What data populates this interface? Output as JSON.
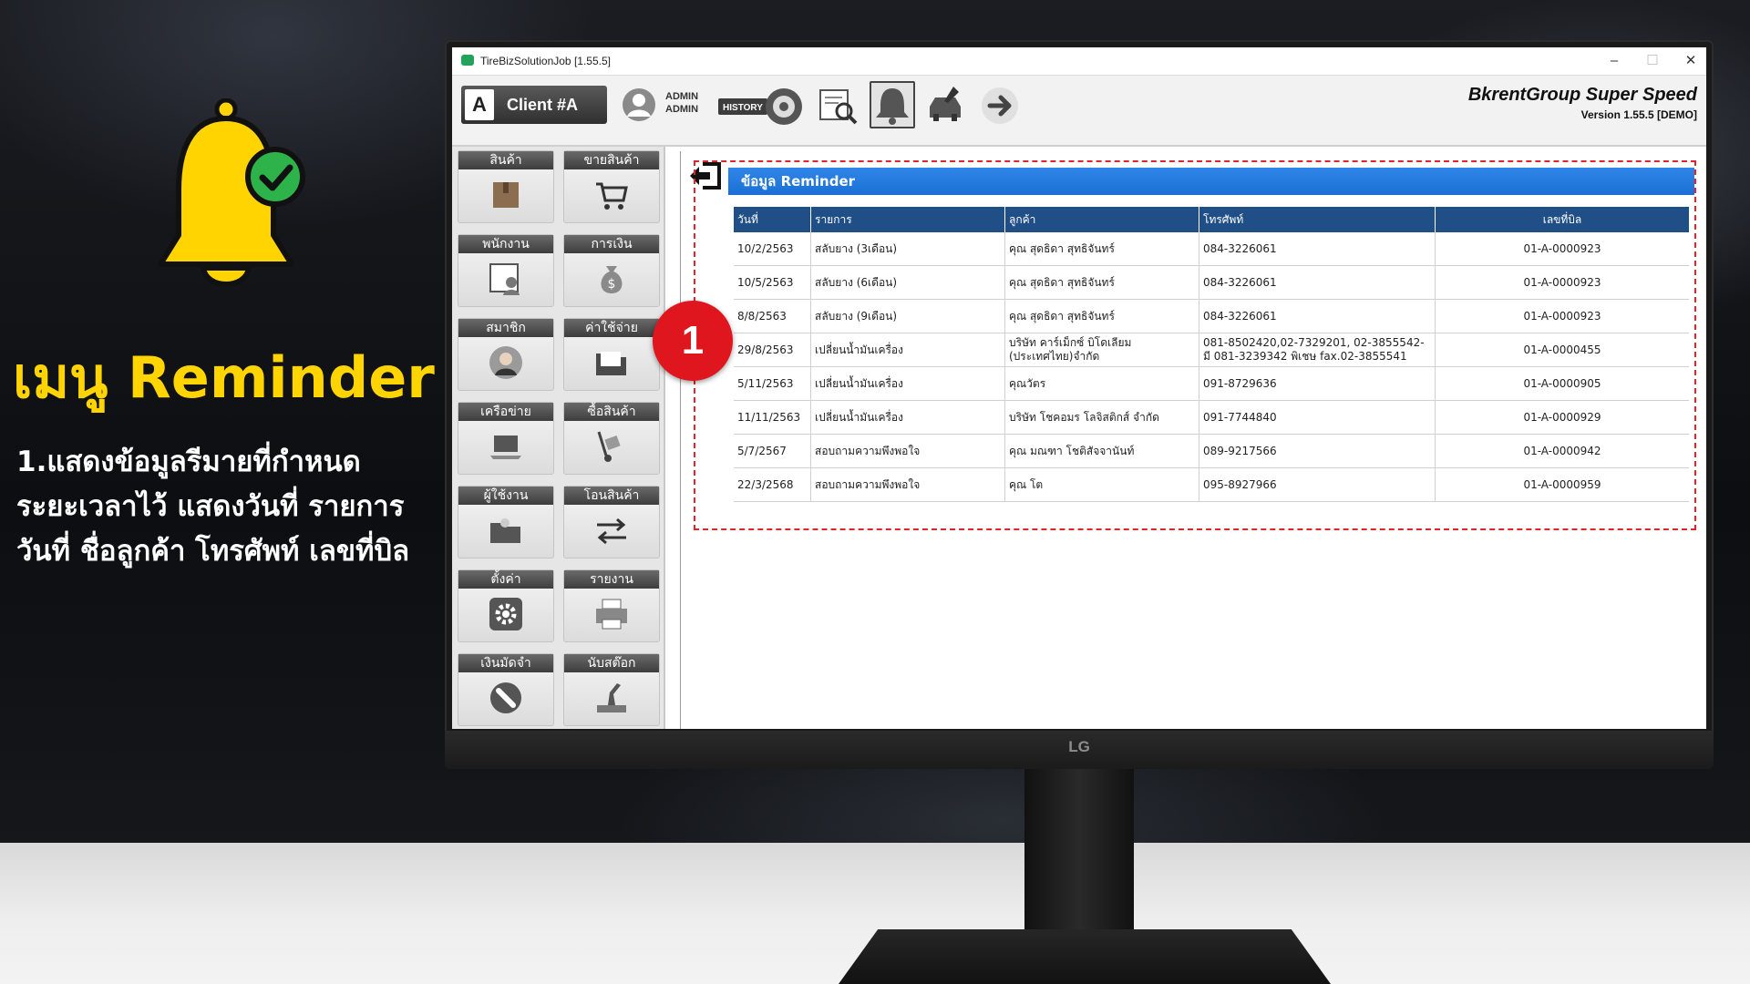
{
  "promo": {
    "title": "เมนู Reminder",
    "lines": [
      "1.แสดงข้อมูลรีมายที่กำหนด",
      "ระยะเวลาไว้ แสดงวันที่ รายการ",
      "วันที่ ชื่อลูกค้า โทรศัพท์ เลขที่บิล"
    ]
  },
  "window": {
    "title": "TireBizSolutionJob [1.55.5]",
    "minimize": "–",
    "maximize": "☐",
    "close": "✕"
  },
  "toolbar": {
    "client_letter": "A",
    "client_label": "Client #A",
    "admin_line1": "ADMIN",
    "admin_line2": "ADMIN",
    "history_label": "HISTORY",
    "brand_name": "BkrentGroup Super Speed",
    "brand_version": "Version 1.55.5 [DEMO]"
  },
  "sidebar": {
    "items": [
      {
        "label": "สินค้า",
        "icon": "box-icon"
      },
      {
        "label": "ขายสินค้า",
        "icon": "cart-icon"
      },
      {
        "label": "พนักงาน",
        "icon": "employee-icon"
      },
      {
        "label": "การเงิน",
        "icon": "money-bag-icon"
      },
      {
        "label": "สมาชิก",
        "icon": "member-icon"
      },
      {
        "label": "ค่าใช้จ่าย",
        "icon": "folder-icon"
      },
      {
        "label": "เครือข่าย",
        "icon": "laptop-icon"
      },
      {
        "label": "ซื้อสินค้า",
        "icon": "hand-truck-icon"
      },
      {
        "label": "ผู้ใช้งาน",
        "icon": "user-folder-icon"
      },
      {
        "label": "โอนสินค้า",
        "icon": "transfer-icon"
      },
      {
        "label": "ตั้งค่า",
        "icon": "gear-icon"
      },
      {
        "label": "รายงาน",
        "icon": "printer-icon"
      },
      {
        "label": "เงินมัดจำ",
        "icon": "deposit-icon"
      },
      {
        "label": "นับสต๊อก",
        "icon": "stamp-icon"
      }
    ]
  },
  "reminder": {
    "title": "ข้อมูล Reminder",
    "badge": "1",
    "columns": [
      "วันที่",
      "รายการ",
      "ลูกค้า",
      "โทรศัพท์",
      "เลขที่บิล"
    ],
    "rows": [
      {
        "date": "10/2/2563",
        "item": "สลับยาง (3เดือน)",
        "customer": "คุณ สุดธิดา สุทธิจันทร์",
        "phone": "084-3226061",
        "bill": "01-A-0000923"
      },
      {
        "date": "10/5/2563",
        "item": "สลับยาง (6เดือน)",
        "customer": "คุณ สุดธิดา สุทธิจันทร์",
        "phone": "084-3226061",
        "bill": "01-A-0000923"
      },
      {
        "date": "8/8/2563",
        "item": "สลับยาง (9เดือน)",
        "customer": "คุณ สุดธิดา สุทธิจันทร์",
        "phone": "084-3226061",
        "bill": "01-A-0000923"
      },
      {
        "date": "29/8/2563",
        "item": "เปลี่ยนน้ำมันเครื่อง",
        "customer": "บริษัท คาร์เม็กซ์ บิโดเลียม (ประเทศไทย)จำกัด",
        "phone": "081-8502420,02-7329201, 02-3855542-มี 081-3239342 พิเชษ fax.02-3855541",
        "bill": "01-A-0000455"
      },
      {
        "date": "5/11/2563",
        "item": "เปลี่ยนน้ำมันเครื่อง",
        "customer": "คุณวัตร",
        "phone": "091-8729636",
        "bill": "01-A-0000905"
      },
      {
        "date": "11/11/2563",
        "item": "เปลี่ยนน้ำมันเครื่อง",
        "customer": "บริษัท โชคอมร โลจิสติกส์ จำกัด",
        "phone": "091-7744840",
        "bill": "01-A-0000929"
      },
      {
        "date": "5/7/2567",
        "item": "สอบถามความพึงพอใจ",
        "customer": "คุณ มณฑา โชติสัจจานันท์",
        "phone": "089-9217566",
        "bill": "01-A-0000942"
      },
      {
        "date": "22/3/2568",
        "item": "สอบถามความพึงพอใจ",
        "customer": "คุณ โต",
        "phone": "095-8927966",
        "bill": "01-A-0000959"
      }
    ]
  },
  "monitor": {
    "brand": "LG"
  },
  "colors": {
    "accent": "#ffd400",
    "header_blue": "#1f4f86",
    "title_blue": "#1b6fd4",
    "badge_red": "#e0161f"
  }
}
